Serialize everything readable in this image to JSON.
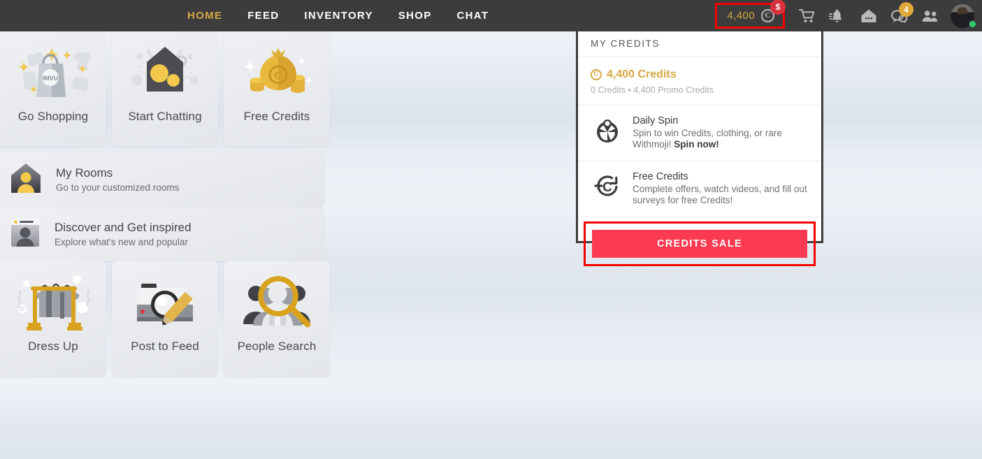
{
  "nav": {
    "links": [
      {
        "label": "HOME",
        "active": true
      },
      {
        "label": "FEED",
        "active": false
      },
      {
        "label": "INVENTORY",
        "active": false
      },
      {
        "label": "SHOP",
        "active": false
      },
      {
        "label": "CHAT",
        "active": false
      }
    ],
    "credits_amount": "4,400",
    "dollar_badge": "$",
    "message_badge": "4",
    "icons": [
      "credits-coin-icon",
      "cart-icon",
      "bell-icon",
      "home-chat-icon",
      "messages-icon",
      "friends-icon",
      "avatar"
    ]
  },
  "panel": {
    "header": "MY CREDITS",
    "balance_title": "4,400 Credits",
    "balance_sub": "0 Credits • 4,400 Promo Credits",
    "rows": [
      {
        "icon": "daily-spin-icon",
        "title": "Daily Spin",
        "desc": "Spin to win Credits, clothing, or rare Withmoji! ",
        "desc_strong": "Spin now!"
      },
      {
        "icon": "free-credits-icon",
        "title": "Free Credits",
        "desc": "Complete offers, watch videos, and fill out surveys for free Credits!",
        "desc_strong": ""
      }
    ],
    "sale_button": "CREDITS SALE",
    "accent_red": "#fc3b52",
    "highlight_red": "#f40000",
    "gold": "#d6a844"
  },
  "tiles": {
    "row1": [
      {
        "label": "Go Shopping",
        "icon": "shopping-bag-icon"
      },
      {
        "label": "Start Chatting",
        "icon": "chat-house-icon"
      },
      {
        "label": "Free Credits",
        "icon": "money-bag-icon"
      }
    ],
    "wide": [
      {
        "title": "My Rooms",
        "sub": "Go to your customized rooms",
        "icon": "rooms-avatar-icon"
      },
      {
        "title": "Discover and Get inspired",
        "sub": "Explore what's new and popular",
        "icon": "discover-card-icon"
      }
    ],
    "row3": [
      {
        "label": "Dress Up",
        "icon": "clothing-rack-icon"
      },
      {
        "label": "Post to Feed",
        "icon": "camera-pencil-icon"
      },
      {
        "label": "People Search",
        "icon": "people-search-icon"
      }
    ]
  }
}
